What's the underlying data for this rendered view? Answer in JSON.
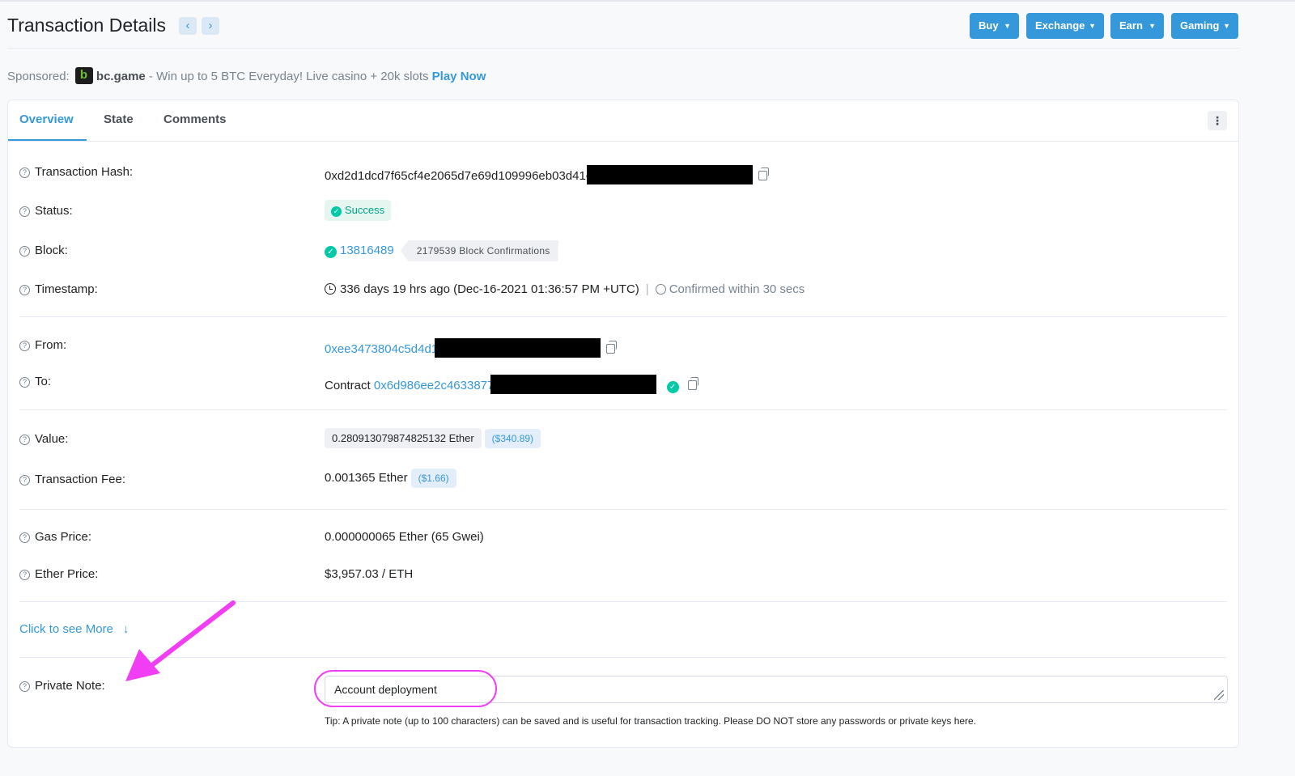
{
  "header": {
    "title": "Transaction Details",
    "menus": [
      {
        "label": "Buy"
      },
      {
        "label": "Exchange"
      },
      {
        "label": "Earn"
      },
      {
        "label": "Gaming"
      }
    ]
  },
  "sponsor": {
    "prefix": "Sponsored:",
    "brand": "bc.game",
    "text": " - Win up to 5 BTC Everyday! Live casino + 20k slots ",
    "cta": "Play Now"
  },
  "tabs": [
    {
      "label": "Overview",
      "active": true
    },
    {
      "label": "State",
      "active": false
    },
    {
      "label": "Comments",
      "active": false
    }
  ],
  "overview": {
    "tx_hash": {
      "label": "Transaction Hash:",
      "value": "0xd2d1dcd7f65cf4e2065d7e69d109996eb03d41c"
    },
    "status": {
      "label": "Status:",
      "value": "Success"
    },
    "block": {
      "label": "Block:",
      "number": "13816489",
      "confirmations": "2179539 Block Confirmations"
    },
    "timestamp": {
      "label": "Timestamp:",
      "value": "336 days 19 hrs ago (Dec-16-2021 01:36:57 PM +UTC)",
      "confirmed": "Confirmed within 30 secs"
    },
    "from": {
      "label": "From:",
      "value": "0xee3473804c5d4d1"
    },
    "to": {
      "label": "To:",
      "prefix": "Contract",
      "value": "0x6d986ee2c4633877"
    },
    "value": {
      "label": "Value:",
      "ether": "0.280913079874825132 Ether",
      "usd": "($340.89)"
    },
    "fee": {
      "label": "Transaction Fee:",
      "ether": "0.001365 Ether",
      "usd": "($1.66)"
    },
    "gas_price": {
      "label": "Gas Price:",
      "value": "0.000000065 Ether (65 Gwei)"
    },
    "ether_price": {
      "label": "Ether Price:",
      "value": "$3,957.03 / ETH"
    },
    "see_more": "Click to see More",
    "private_note": {
      "label": "Private Note:",
      "value": "Account deployment",
      "tip": "Tip: A private note (up to 100 characters) can be saved and is useful for transaction tracking. Please DO NOT store any passwords or private keys here."
    }
  },
  "colors": {
    "accent": "#3498db",
    "success": "#00c9a7",
    "annotation": "#f13ef5"
  }
}
